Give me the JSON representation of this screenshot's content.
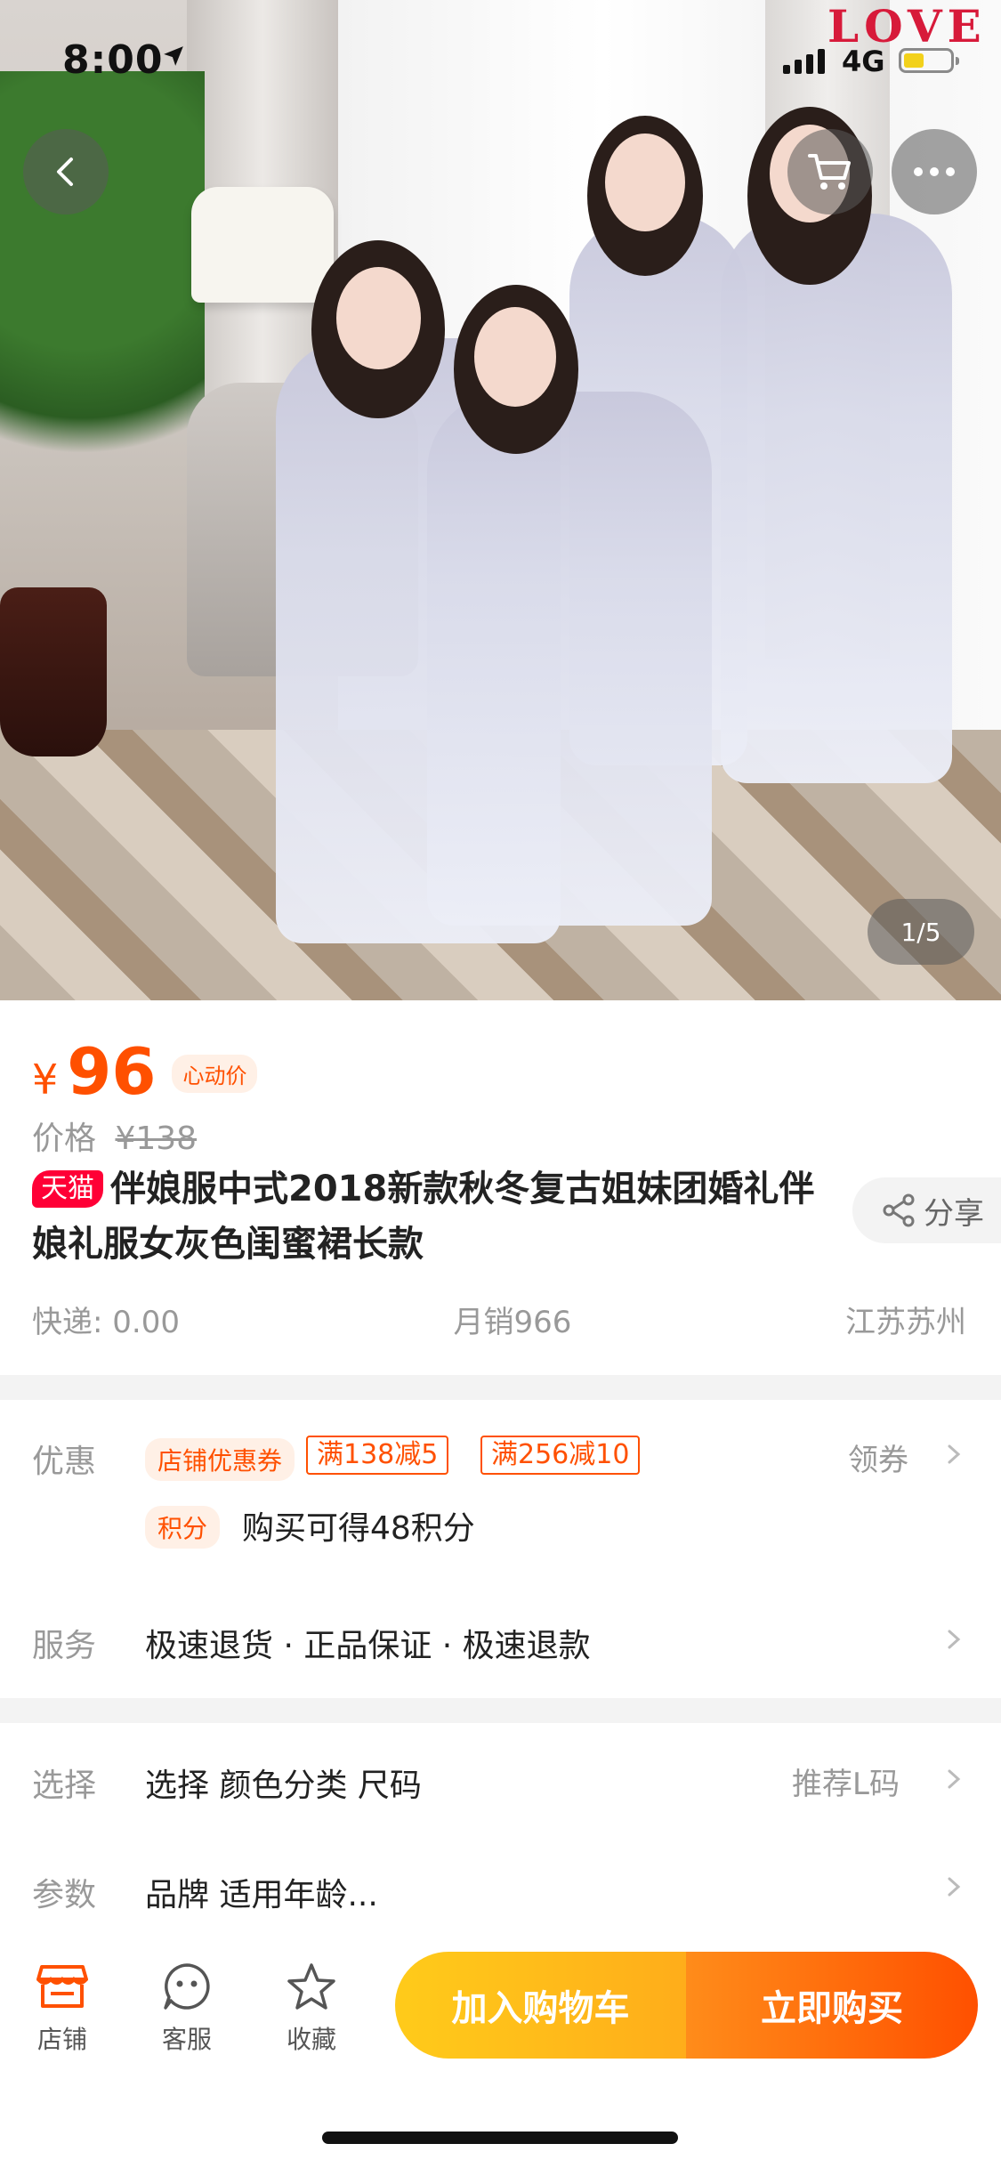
{
  "status_bar": {
    "time": "8:00",
    "network": "4G"
  },
  "gallery": {
    "pager": "1/5",
    "decor_text": "LOVE"
  },
  "price": {
    "currency": "¥",
    "value": "96",
    "tag": "心动价"
  },
  "original_price": {
    "label": "价格",
    "value": "¥138"
  },
  "product": {
    "badge": "天猫",
    "title": "伴娘服中式2018新款秋冬复古姐妹团婚礼伴娘礼服女灰色闺蜜裙长款",
    "share_label": "分享"
  },
  "meta": {
    "shipping": "快递: 0.00",
    "monthly_sales": "月销966",
    "location": "江苏苏州"
  },
  "promotions": {
    "label": "优惠",
    "store_coupon": "店铺优惠券",
    "coupons": [
      "满138减5",
      "满256减10"
    ],
    "claim_label": "领券",
    "points_badge": "积分",
    "points_text": "购买可得48积分"
  },
  "service": {
    "label": "服务",
    "text": "极速退货 · 正品保证 · 极速退款"
  },
  "selection": {
    "label": "选择",
    "text": "选择  颜色分类 尺码",
    "recommend": "推荐L码"
  },
  "params": {
    "label": "参数",
    "text": "品牌 适用年龄..."
  },
  "bottom_bar": {
    "store": "店铺",
    "service": "客服",
    "favorite": "收藏",
    "add_to_cart": "加入购物车",
    "buy_now": "立即购买"
  },
  "colors": {
    "accent": "#ff5000",
    "tmall_red": "#ff0036",
    "cart_yellow": "#ffcb1a"
  }
}
